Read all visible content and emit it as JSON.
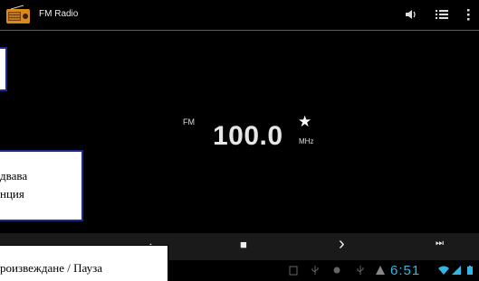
{
  "app": {
    "title": "FM Radio"
  },
  "tuner": {
    "band": "FM",
    "frequency": "100.0",
    "unit": "MHz",
    "favorite_star": "★"
  },
  "controls": {
    "stop_glyph": "■",
    "next_glyph": "›",
    "skip_glyph": "⏭"
  },
  "status_bar": {
    "time": "6:51"
  },
  "callouts": {
    "middle": [
      "двава",
      "нция"
    ],
    "bottom": "роизвеждане / Пауза"
  },
  "colors": {
    "accent": "#33b5e5",
    "divider": "#2b6e8f",
    "callout_border": "#1c2a8c"
  }
}
